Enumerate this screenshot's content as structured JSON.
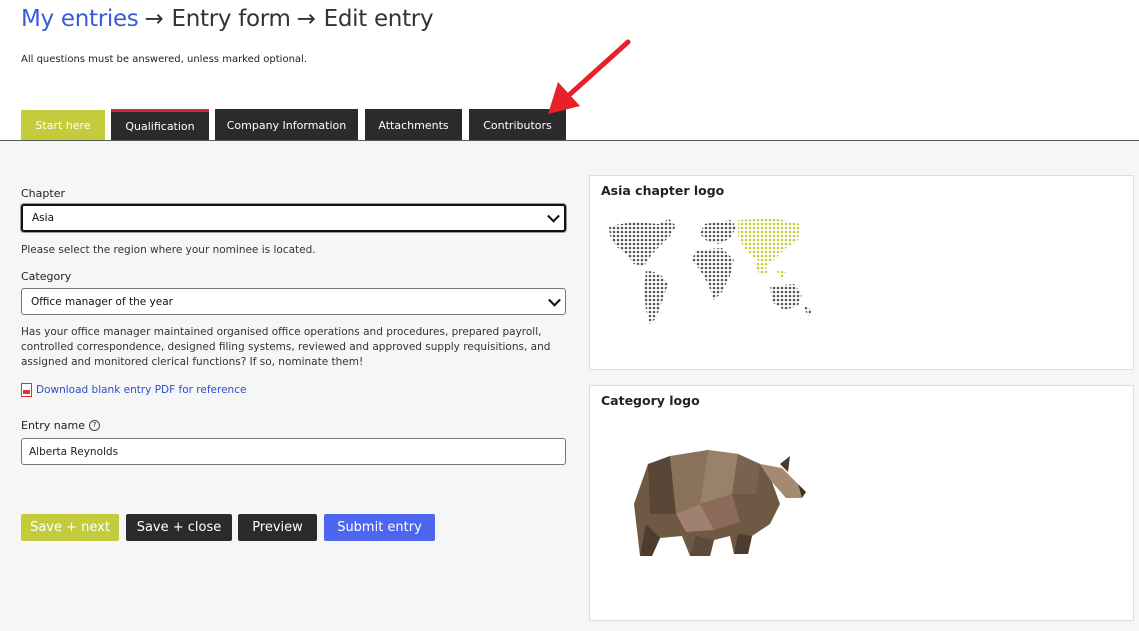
{
  "breadcrumb": {
    "home": "My entries",
    "form": "Entry form",
    "current": "Edit entry",
    "separator": "→"
  },
  "note": "All questions must be answered, unless marked optional.",
  "tabs": [
    {
      "label": "Start here",
      "active": true
    },
    {
      "label": "Qualification"
    },
    {
      "label": "Company Information"
    },
    {
      "label": "Attachments"
    },
    {
      "label": "Contributors"
    }
  ],
  "form": {
    "chapter_label": "Chapter",
    "chapter_value": "Asia",
    "chapter_help": "Please select the region where your nominee is located.",
    "category_label": "Category",
    "category_value": "Office manager of the year",
    "category_help": "Has your office manager maintained organised office operations and procedures, prepared payroll, controlled correspondence, designed filing systems, reviewed and approved supply requisitions, and assigned and monitored clerical functions? If so, nominate them!",
    "pdf_link": "Download blank entry PDF for reference",
    "entry_name_label": "Entry name",
    "entry_name_value": "Alberta Reynolds"
  },
  "buttons": {
    "save_next": "Save + next",
    "save_close": "Save + close",
    "preview": "Preview",
    "submit": "Submit entry"
  },
  "cards": {
    "chapter_logo_title": "Asia chapter logo",
    "category_logo_title": "Category logo"
  },
  "colors": {
    "accent": "#c4cc3d",
    "dark": "#2b2b2b",
    "primary": "#4d66f0",
    "link": "#3b5bd6",
    "tab_highlight": "#d6243a"
  }
}
